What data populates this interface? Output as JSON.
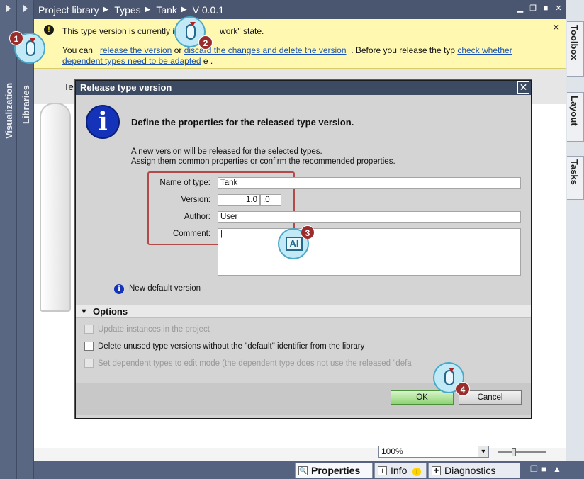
{
  "left_panels": {
    "visualization_label": "Visualization",
    "libraries_label": "Libraries"
  },
  "right_panels": {
    "toolbox_label": "Toolbox",
    "layout_label": "Layout",
    "tasks_label": "Tasks"
  },
  "breadcrumb": {
    "items": [
      "Project library",
      "Types",
      "Tank",
      "V 0.0.1"
    ]
  },
  "info_bar": {
    "line1": "This type version is currently i",
    "line1_tail": "work\" state.",
    "you_can": "You can",
    "link_release": "release the version",
    "or": "or",
    "link_discard": "discard the changes and delete the version",
    "before_release": ". Before you release the typ",
    "link_check": "check whether dependent types need to be adapted",
    "tail": "e ."
  },
  "canvas": {
    "label_fragment": "Te"
  },
  "dialog": {
    "title": "Release type version",
    "heading": "Define the properties for the released type version.",
    "desc_line1": "A new version will be released for the selected types.",
    "desc_line2": "Assign them common properties or confirm the recommended properties.",
    "fields": {
      "name_label": "Name of type:",
      "name_value": "Tank",
      "version_label": "Version:",
      "version_major": "1.0",
      "version_minor": ".0",
      "author_label": "Author:",
      "author_value": "User",
      "comment_label": "Comment:",
      "comment_value": "|"
    },
    "new_default": "New default version",
    "options_title": "Options",
    "options": [
      {
        "label": "Update instances in the project",
        "checked": false,
        "enabled": false
      },
      {
        "label": "Delete unused type versions without the \"default\" identifier from the library",
        "checked": false,
        "enabled": true
      },
      {
        "label": "Set dependent types to edit mode (the dependent type does not use the released \"defa",
        "checked": false,
        "enabled": false
      }
    ],
    "ok_label": "OK",
    "cancel_label": "Cancel"
  },
  "zoom": {
    "value": "100%"
  },
  "bottom_tabs": {
    "properties": "Properties",
    "info": "Info",
    "diagnostics": "Diagnostics"
  },
  "steps": [
    "1",
    "2",
    "3",
    "4"
  ]
}
